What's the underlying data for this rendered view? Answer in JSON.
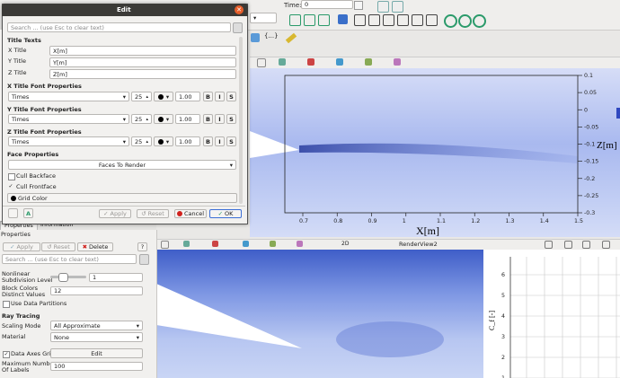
{
  "toolbar": {
    "time_label": "Time:",
    "time_value": "0",
    "view_button": "{...}"
  },
  "dialog": {
    "title": "Edit",
    "search_placeholder": "Search ... (use Esc to clear text)",
    "title_texts_header": "Title Texts",
    "x_title_label": "X Title",
    "x_title_value": "X[m]",
    "y_title_label": "Y Title",
    "y_title_value": "Y[m]",
    "z_title_label": "Z Title",
    "z_title_value": "Z[m]",
    "font_rows": [
      {
        "header": "X Title Font Properties",
        "font": "Times",
        "size": "25",
        "opacity": "1.00"
      },
      {
        "header": "Y Title Font Properties",
        "font": "Times",
        "size": "25",
        "opacity": "1.00"
      },
      {
        "header": "Z Title Font Properties",
        "font": "Times",
        "size": "25",
        "opacity": "1.00"
      }
    ],
    "bold": "B",
    "italic": "I",
    "shadow": "S",
    "face_header": "Face Properties",
    "faces_to_render": "Faces To Render",
    "cull_backface": "Cull Backface",
    "cull_frontface": "Cull Frontface",
    "grid_color": "Grid Color",
    "apply": "Apply",
    "reset": "Reset",
    "cancel": "Cancel",
    "ok": "OK"
  },
  "panel": {
    "tab_properties": "Properties",
    "tab_information": "Information",
    "header": "Properties",
    "apply": "Apply",
    "reset": "Reset",
    "delete": "Delete",
    "help": "?",
    "search_placeholder": "Search ... (use Esc to clear text)",
    "nonlinear_label_1": "Nonlinear",
    "nonlinear_label_2": "Subdivision Level",
    "nonlinear_value": "1",
    "block_colors_label_1": "Block Colors",
    "block_colors_label_2": "Distinct Values",
    "block_colors_value": "12",
    "use_data_partitions": "Use Data Partitions",
    "ray_tracing_header": "Ray Tracing",
    "scaling_mode_label": "Scaling Mode",
    "scaling_mode_value": "All Approximate",
    "material_label": "Material",
    "material_value": "None",
    "data_axes_grid": "Data Axes Grid",
    "edit_button": "Edit",
    "max_labels_label_1": "Maximum Number",
    "max_labels_label_2": "Of Labels",
    "max_labels_value": "100"
  },
  "view": {
    "top_x_ticks": [
      "0.7",
      "0.8",
      "0.9",
      "1",
      "1.1",
      "1.2",
      "1.3",
      "1.4",
      "1.5"
    ],
    "top_y_ticks": [
      "0.1",
      "0.05",
      "0",
      "-0.05",
      "-0.1",
      "-0.15",
      "-0.2",
      "-0.25",
      "-0.3"
    ],
    "x_axis_title": "X[m]",
    "z_axis_title": "Z[m]",
    "renderview2_label": "RenderView2",
    "twod_label": "2D",
    "chart_y_ticks": [
      "6",
      "5",
      "4",
      "3",
      "2",
      "1"
    ],
    "chart_y_label": "C_f [-]"
  },
  "colors": {
    "accent": "#3c6fd6",
    "delete": "#d0211d",
    "cancel_icon": "#d0211d",
    "dialog_title_bg": "#3b3a37",
    "field_bg": "#b8c6ee"
  }
}
